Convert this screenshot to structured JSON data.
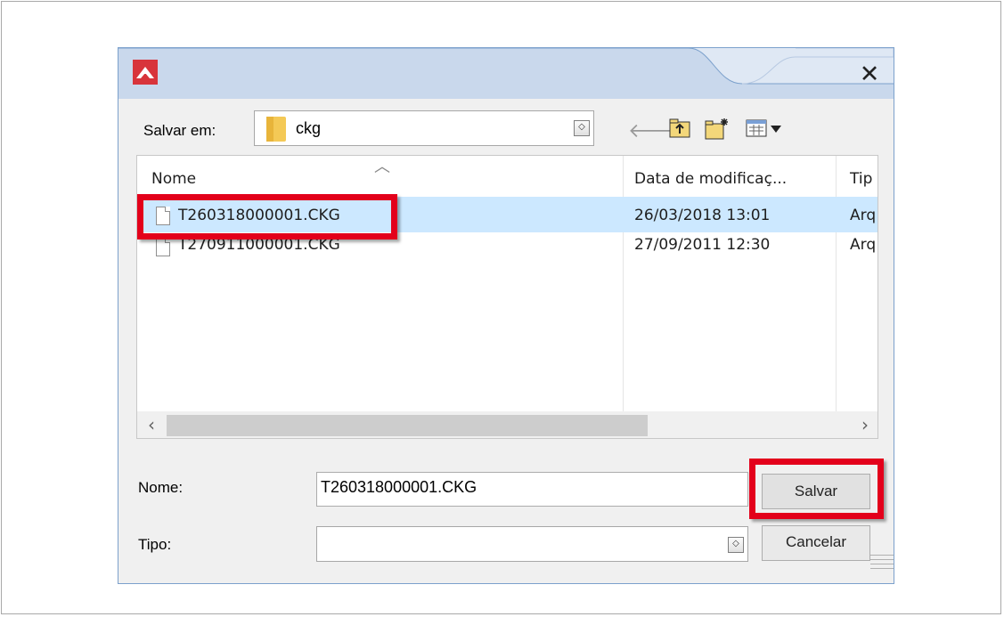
{
  "dialog": {
    "close_glyph": "✕",
    "save_in_label": "Salvar em:",
    "current_folder": "ckg",
    "columns": {
      "name": "Nome",
      "date": "Data de modificaç...",
      "type": "Tip"
    },
    "files": [
      {
        "name": "T260318000001.CKG",
        "date": "26/03/2018 13:01",
        "type": "Arq",
        "selected": true
      },
      {
        "name": "T270911000001.CKG",
        "date": "27/09/2011 12:30",
        "type": "Arq",
        "selected": false
      }
    ],
    "filename_label": "Nome:",
    "filename_value": "T260318000001.CKG",
    "type_label": "Tipo:",
    "type_value": "",
    "save_button": "Salvar",
    "cancel_button": "Cancelar",
    "toolbar_icons": [
      "back-arrow-icon",
      "up-folder-icon",
      "new-folder-icon",
      "view-menu-icon"
    ],
    "colors": {
      "highlight": "#e3001b",
      "selection": "#cce8ff",
      "app_icon": "#d8343b"
    }
  }
}
